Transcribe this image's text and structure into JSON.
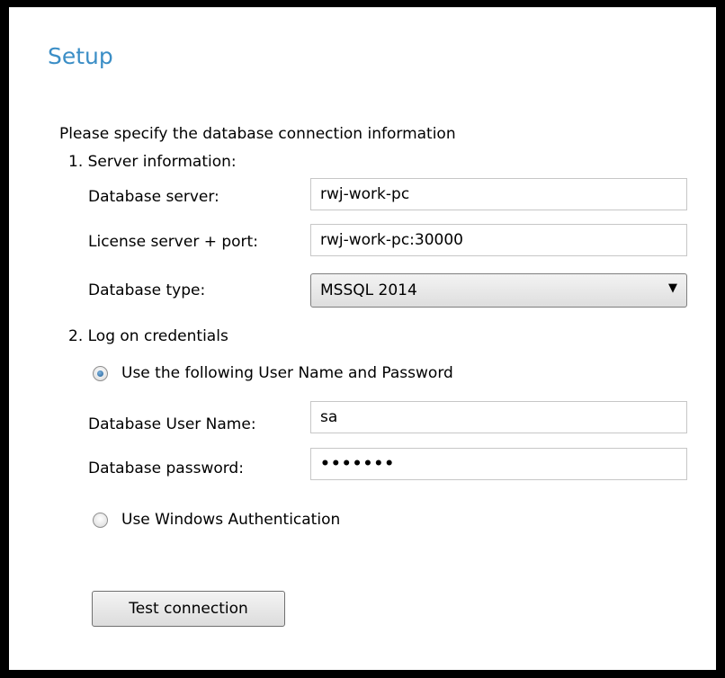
{
  "title": "Setup",
  "intro": "Please specify the database connection information",
  "server_section": {
    "heading": "1. Server information:",
    "db_server": {
      "label": "Database server:",
      "value": "rwj-work-pc"
    },
    "license_server": {
      "label": "License server + port:",
      "value": "rwj-work-pc:30000"
    },
    "db_type": {
      "label": "Database type:",
      "selected": "MSSQL 2014",
      "arrow_icon": "▼"
    }
  },
  "credentials_section": {
    "heading": "2. Log on credentials",
    "option_userpass": {
      "label": "Use the following User Name and Password",
      "selected": true
    },
    "user_name": {
      "label": "Database User Name:",
      "value": "sa"
    },
    "password": {
      "label": "Database password:",
      "value": "•••••••"
    },
    "option_windows": {
      "label": "Use Windows Authentication",
      "selected": false
    }
  },
  "test_button": {
    "label": "Test connection"
  },
  "colors": {
    "title": "#3b8ec6",
    "frame": "#000000",
    "field_border": "#c7c7c7"
  }
}
